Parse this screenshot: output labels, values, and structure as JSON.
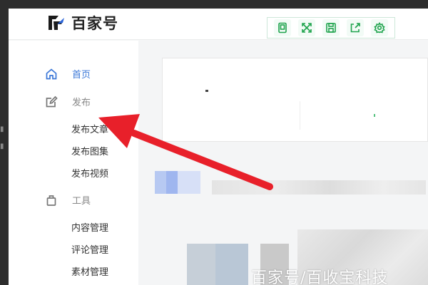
{
  "brand": {
    "name": "百家号"
  },
  "toolbar": {
    "buttons": [
      {
        "icon": "tablet-icon"
      },
      {
        "icon": "fullscreen-icon"
      },
      {
        "icon": "save-icon"
      },
      {
        "icon": "share-icon"
      },
      {
        "icon": "gear-icon"
      }
    ],
    "accent": "#1ea34c"
  },
  "sidebar": {
    "home": {
      "label": "首页",
      "icon": "home-icon",
      "color": "#3c78d8"
    },
    "publish": {
      "label": "发布",
      "icon": "edit-icon",
      "items": [
        "发布文章",
        "发布图集",
        "发布视频"
      ]
    },
    "tools": {
      "label": "工具",
      "icon": "bag-icon",
      "items": [
        "内容管理",
        "评论管理",
        "素材管理"
      ]
    }
  },
  "annotation": {
    "color": "#e8202a",
    "target": "发布文章"
  },
  "watermark": "百家号/百收宝科技"
}
